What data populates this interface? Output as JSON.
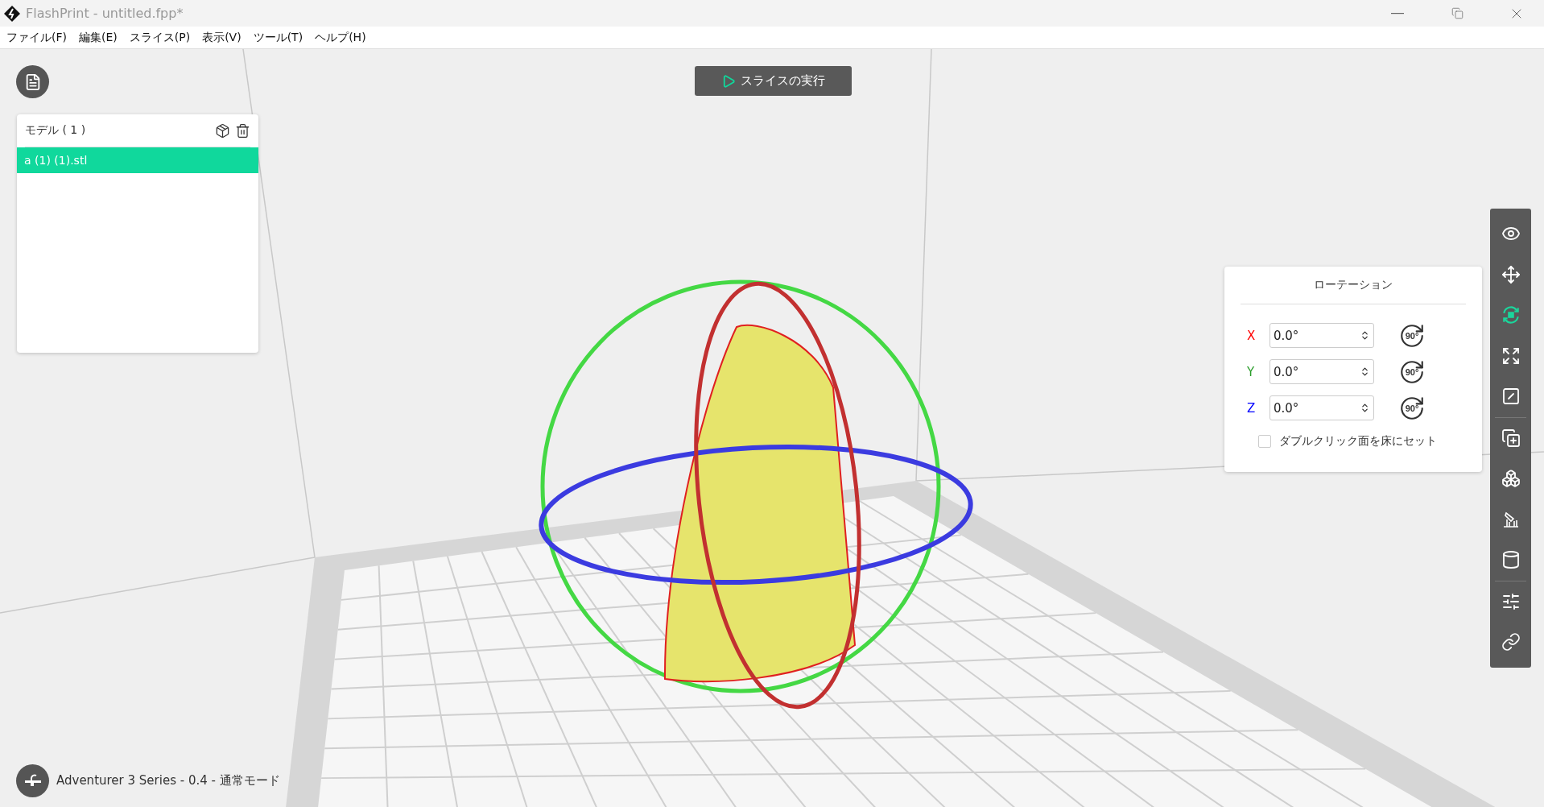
{
  "window": {
    "title": "FlashPrint - untitled.fpp*"
  },
  "menu": [
    "ファイル(F)",
    "編集(E)",
    "スライス(P)",
    "表示(V)",
    "ツール(T)",
    "ヘルプ(H)"
  ],
  "slice_button": {
    "label": "スライスの実行"
  },
  "model_panel": {
    "title": "モデル ( 1 )",
    "items": [
      {
        "name": "a (1) (1).stl",
        "selected": true
      }
    ]
  },
  "rotation_panel": {
    "title": "ローテーション",
    "axes": [
      {
        "label": "X",
        "color": "#ff0000",
        "value": "0.0°",
        "rotate_label": "90°"
      },
      {
        "label": "Y",
        "color": "#2a9d2a",
        "value": "0.0°",
        "rotate_label": "90°"
      },
      {
        "label": "Z",
        "color": "#0000ff",
        "value": "0.0°",
        "rotate_label": "90°"
      }
    ],
    "checkbox": {
      "label": "ダブルクリック面を床にセット",
      "checked": false
    }
  },
  "toolbar": {
    "groups": [
      [
        {
          "kind": "view",
          "selected": false
        },
        {
          "kind": "move",
          "selected": false
        },
        {
          "kind": "rotate",
          "selected": true
        },
        {
          "kind": "scale",
          "selected": false
        },
        {
          "kind": "cut",
          "selected": false
        }
      ],
      [
        {
          "kind": "add",
          "selected": false
        },
        {
          "kind": "split",
          "selected": false
        },
        {
          "kind": "support",
          "selected": false
        },
        {
          "kind": "hollow",
          "selected": false
        }
      ],
      [
        {
          "kind": "settings",
          "selected": false
        },
        {
          "kind": "link",
          "selected": false
        }
      ]
    ]
  },
  "status": {
    "text": "Adventurer 3 Series - 0.4 - 通常モード"
  }
}
